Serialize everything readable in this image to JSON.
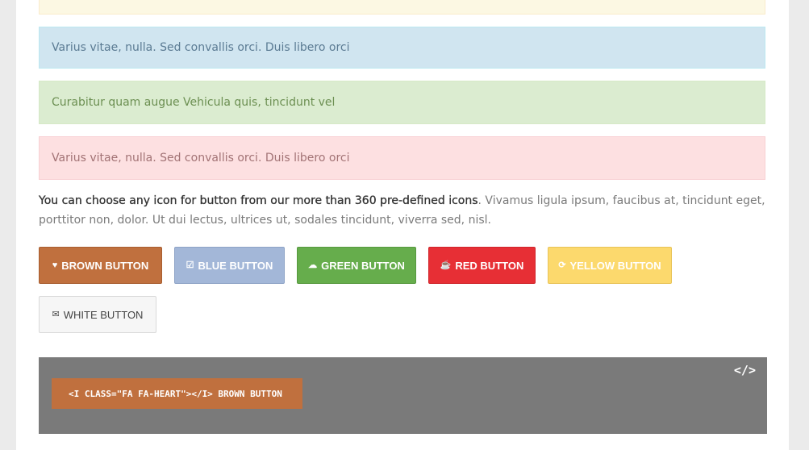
{
  "alerts": {
    "info": "Varius vitae, nulla. Sed convallis orci. Duis libero orci",
    "success": "Curabitur quam augue Vehicula quis, tincidunt vel",
    "danger": "Varius vitae, nulla. Sed convallis orci. Duis libero orci"
  },
  "description": {
    "highlight": "You can choose any icon for button from our more than 360 pre-defined icons",
    "rest": ". Vivamus ligula ipsum, faucibus at, tincidunt eget, porttitor non, dolor. Ut dui lectus, ultrices ut, sodales tincidunt, viverra sed, nisl."
  },
  "buttons": {
    "brown": {
      "label": "BROWN BUTTON",
      "icon": "heart-icon",
      "glyph": "♥",
      "color": "#c0703e"
    },
    "blue": {
      "label": "BLUE BUTTON",
      "icon": "check-square-icon",
      "glyph": "☑",
      "color": "#a3b7d8"
    },
    "green": {
      "label": "GREEN BUTTON",
      "icon": "cloud-download-icon",
      "glyph": "☁",
      "color": "#66ad4c"
    },
    "red": {
      "label": "RED BUTTON",
      "icon": "coffee-icon",
      "glyph": "☕",
      "color": "#e72f35"
    },
    "yellow": {
      "label": "YELLOW BUTTON",
      "icon": "refresh-icon",
      "glyph": "⟳",
      "color": "#fcd96d"
    },
    "white": {
      "label": "WHITE BUTTON",
      "icon": "envelope-icon",
      "glyph": "✉",
      "color": "#f6f6f6"
    }
  },
  "code": {
    "toggle": "</>",
    "snippet": "<I CLASS=\"FA FA-HEART\"></I> BROWN BUTTON"
  }
}
